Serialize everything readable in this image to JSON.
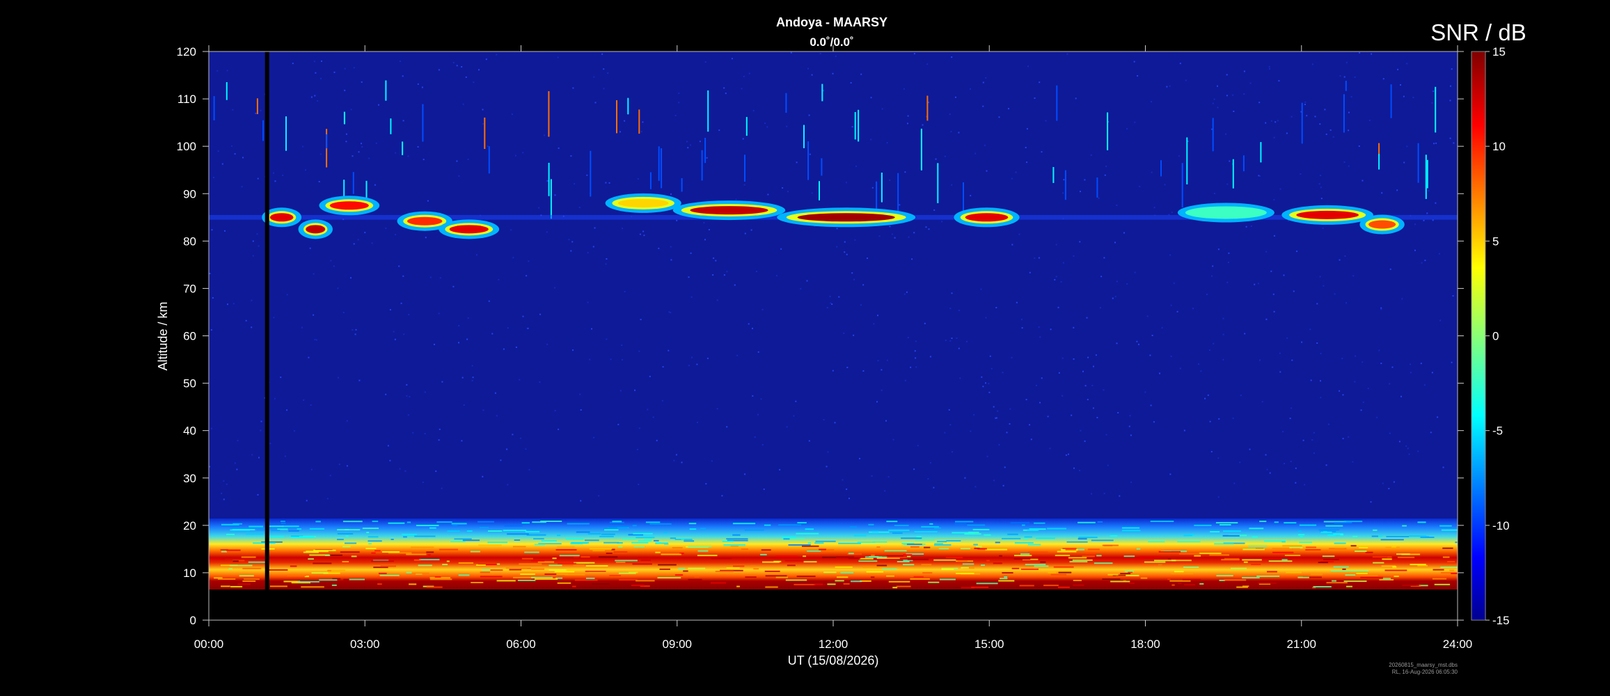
{
  "chart_data": {
    "type": "heatmap",
    "title": "Andoya - MAARSY",
    "subtitle": "0.0˚/0.0˚",
    "xlabel": "UT (15/08/2026)",
    "ylabel": "Altitude / km",
    "colorbar_label": "SNR / dB",
    "x_ticks": [
      "00:00",
      "03:00",
      "06:00",
      "09:00",
      "12:00",
      "15:00",
      "18:00",
      "21:00",
      "24:00"
    ],
    "x_range_hours": [
      0,
      24
    ],
    "y_ticks": [
      0,
      10,
      20,
      30,
      40,
      50,
      60,
      70,
      80,
      90,
      100,
      110,
      120
    ],
    "ylim": [
      0,
      120
    ],
    "colorbar_ticks": [
      15,
      10,
      5,
      0,
      -5,
      -10,
      -15
    ],
    "zlim": [
      -15,
      15
    ],
    "colormap": "jet",
    "data_gap_hours": [
      1.08,
      1.16
    ],
    "layers": [
      {
        "name": "background noise",
        "alt_km": [
          25,
          120
        ],
        "snr_db": -12
      },
      {
        "name": "lower echoes",
        "alt_km": [
          7,
          20
        ],
        "snr_db": [
          0,
          15
        ]
      },
      {
        "name": "mesospheric echoes",
        "alt_km": [
          80,
          89
        ],
        "time_h": [
          0,
          24
        ],
        "peak_snr_db": 15
      }
    ],
    "echo_patches": [
      {
        "time_h": [
          1.1,
          1.7
        ],
        "alt_km": 85.0,
        "snr_db": 12
      },
      {
        "time_h": [
          1.8,
          2.3
        ],
        "alt_km": 82.5,
        "snr_db": 13
      },
      {
        "time_h": [
          2.2,
          3.2
        ],
        "alt_km": 87.5,
        "snr_db": 11
      },
      {
        "time_h": [
          3.7,
          4.6
        ],
        "alt_km": 84.2,
        "snr_db": 10
      },
      {
        "time_h": [
          4.5,
          5.5
        ],
        "alt_km": 82.5,
        "snr_db": 12
      },
      {
        "time_h": [
          7.7,
          9.0
        ],
        "alt_km": 88.0,
        "snr_db": 5
      },
      {
        "time_h": [
          9.0,
          11.0
        ],
        "alt_km": 86.5,
        "snr_db": 13
      },
      {
        "time_h": [
          11.0,
          13.5
        ],
        "alt_km": 85.0,
        "snr_db": 14
      },
      {
        "time_h": [
          14.4,
          15.5
        ],
        "alt_km": 85.0,
        "snr_db": 12
      },
      {
        "time_h": [
          18.7,
          20.4
        ],
        "alt_km": 86.0,
        "snr_db": -2
      },
      {
        "time_h": [
          20.7,
          22.3
        ],
        "alt_km": 85.5,
        "snr_db": 12
      },
      {
        "time_h": [
          22.2,
          22.9
        ],
        "alt_km": 83.5,
        "snr_db": 9
      }
    ]
  },
  "footer": {
    "file": "20260815_maarsy_mst.dbs",
    "stamp": "RL, 16-Aug-2026 06:05:30"
  }
}
